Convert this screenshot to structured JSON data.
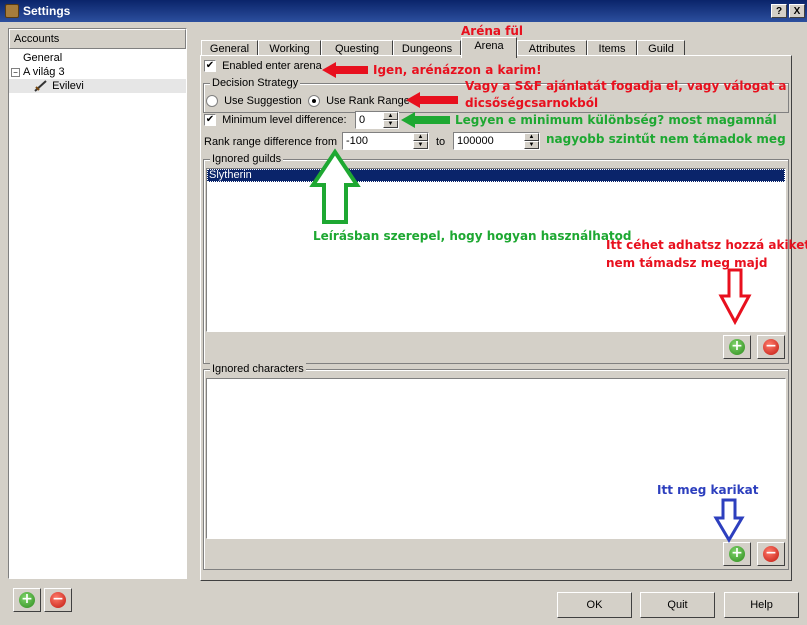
{
  "window": {
    "title": "Settings",
    "help_label": "?",
    "close_label": "X"
  },
  "sidebar": {
    "header": "Accounts",
    "items": [
      {
        "label": "General"
      },
      {
        "label": "A világ 3",
        "expander": "−"
      },
      {
        "label": "Evilevi"
      }
    ]
  },
  "tabs": [
    {
      "label": "General"
    },
    {
      "label": "Working"
    },
    {
      "label": "Questing"
    },
    {
      "label": "Dungeons"
    },
    {
      "label": "Arena"
    },
    {
      "label": "Attributes"
    },
    {
      "label": "Items"
    },
    {
      "label": "Guild"
    }
  ],
  "arena": {
    "enabled_label": "Enabled enter arena",
    "enabled_checked": "✔",
    "decision_group": "Decision Strategy",
    "use_suggestion_label": "Use Suggestion",
    "use_rank_range_label": "Use Rank Range",
    "min_level_label": "Minimum level difference:",
    "min_level_checked": "✔",
    "min_level_value": "0",
    "rank_from_label": "Rank range difference from",
    "rank_from_value": "-100",
    "to_label": "to",
    "rank_to_value": "100000",
    "ignored_guilds_label": "Ignored guilds",
    "ignored_guilds": [
      "Slytherin"
    ],
    "ignored_characters_label": "Ignored characters"
  },
  "annotations": {
    "tab_title": "Aréna fül",
    "enable": "Igen, arénázzon a karim!",
    "strategy_line1": "Vagy a S&F ajánlatát fogadja el, vagy válogat a",
    "strategy_line2": "dicsőségcsarnokból",
    "min_level_line1": "Legyen e minimum különbség? most magamnál",
    "min_level_line2": "nagyobb szintűt nem támadok meg",
    "description": "Leírásban szerepel, hogy hogyan használhatod",
    "guilds_line1": "Itt céhet adhatsz hozzá akiket",
    "guilds_line2": "nem támadsz meg majd",
    "chars": "Itt meg karikat"
  },
  "buttons": {
    "ok": "OK",
    "quit": "Quit",
    "help": "Help",
    "add_symbol": "+",
    "remove_symbol": "−"
  },
  "colors": {
    "annotation_red": "#e8101e",
    "annotation_green": "#1ea832",
    "annotation_blue": "#2d3fbe",
    "selection": "#0a246a"
  }
}
